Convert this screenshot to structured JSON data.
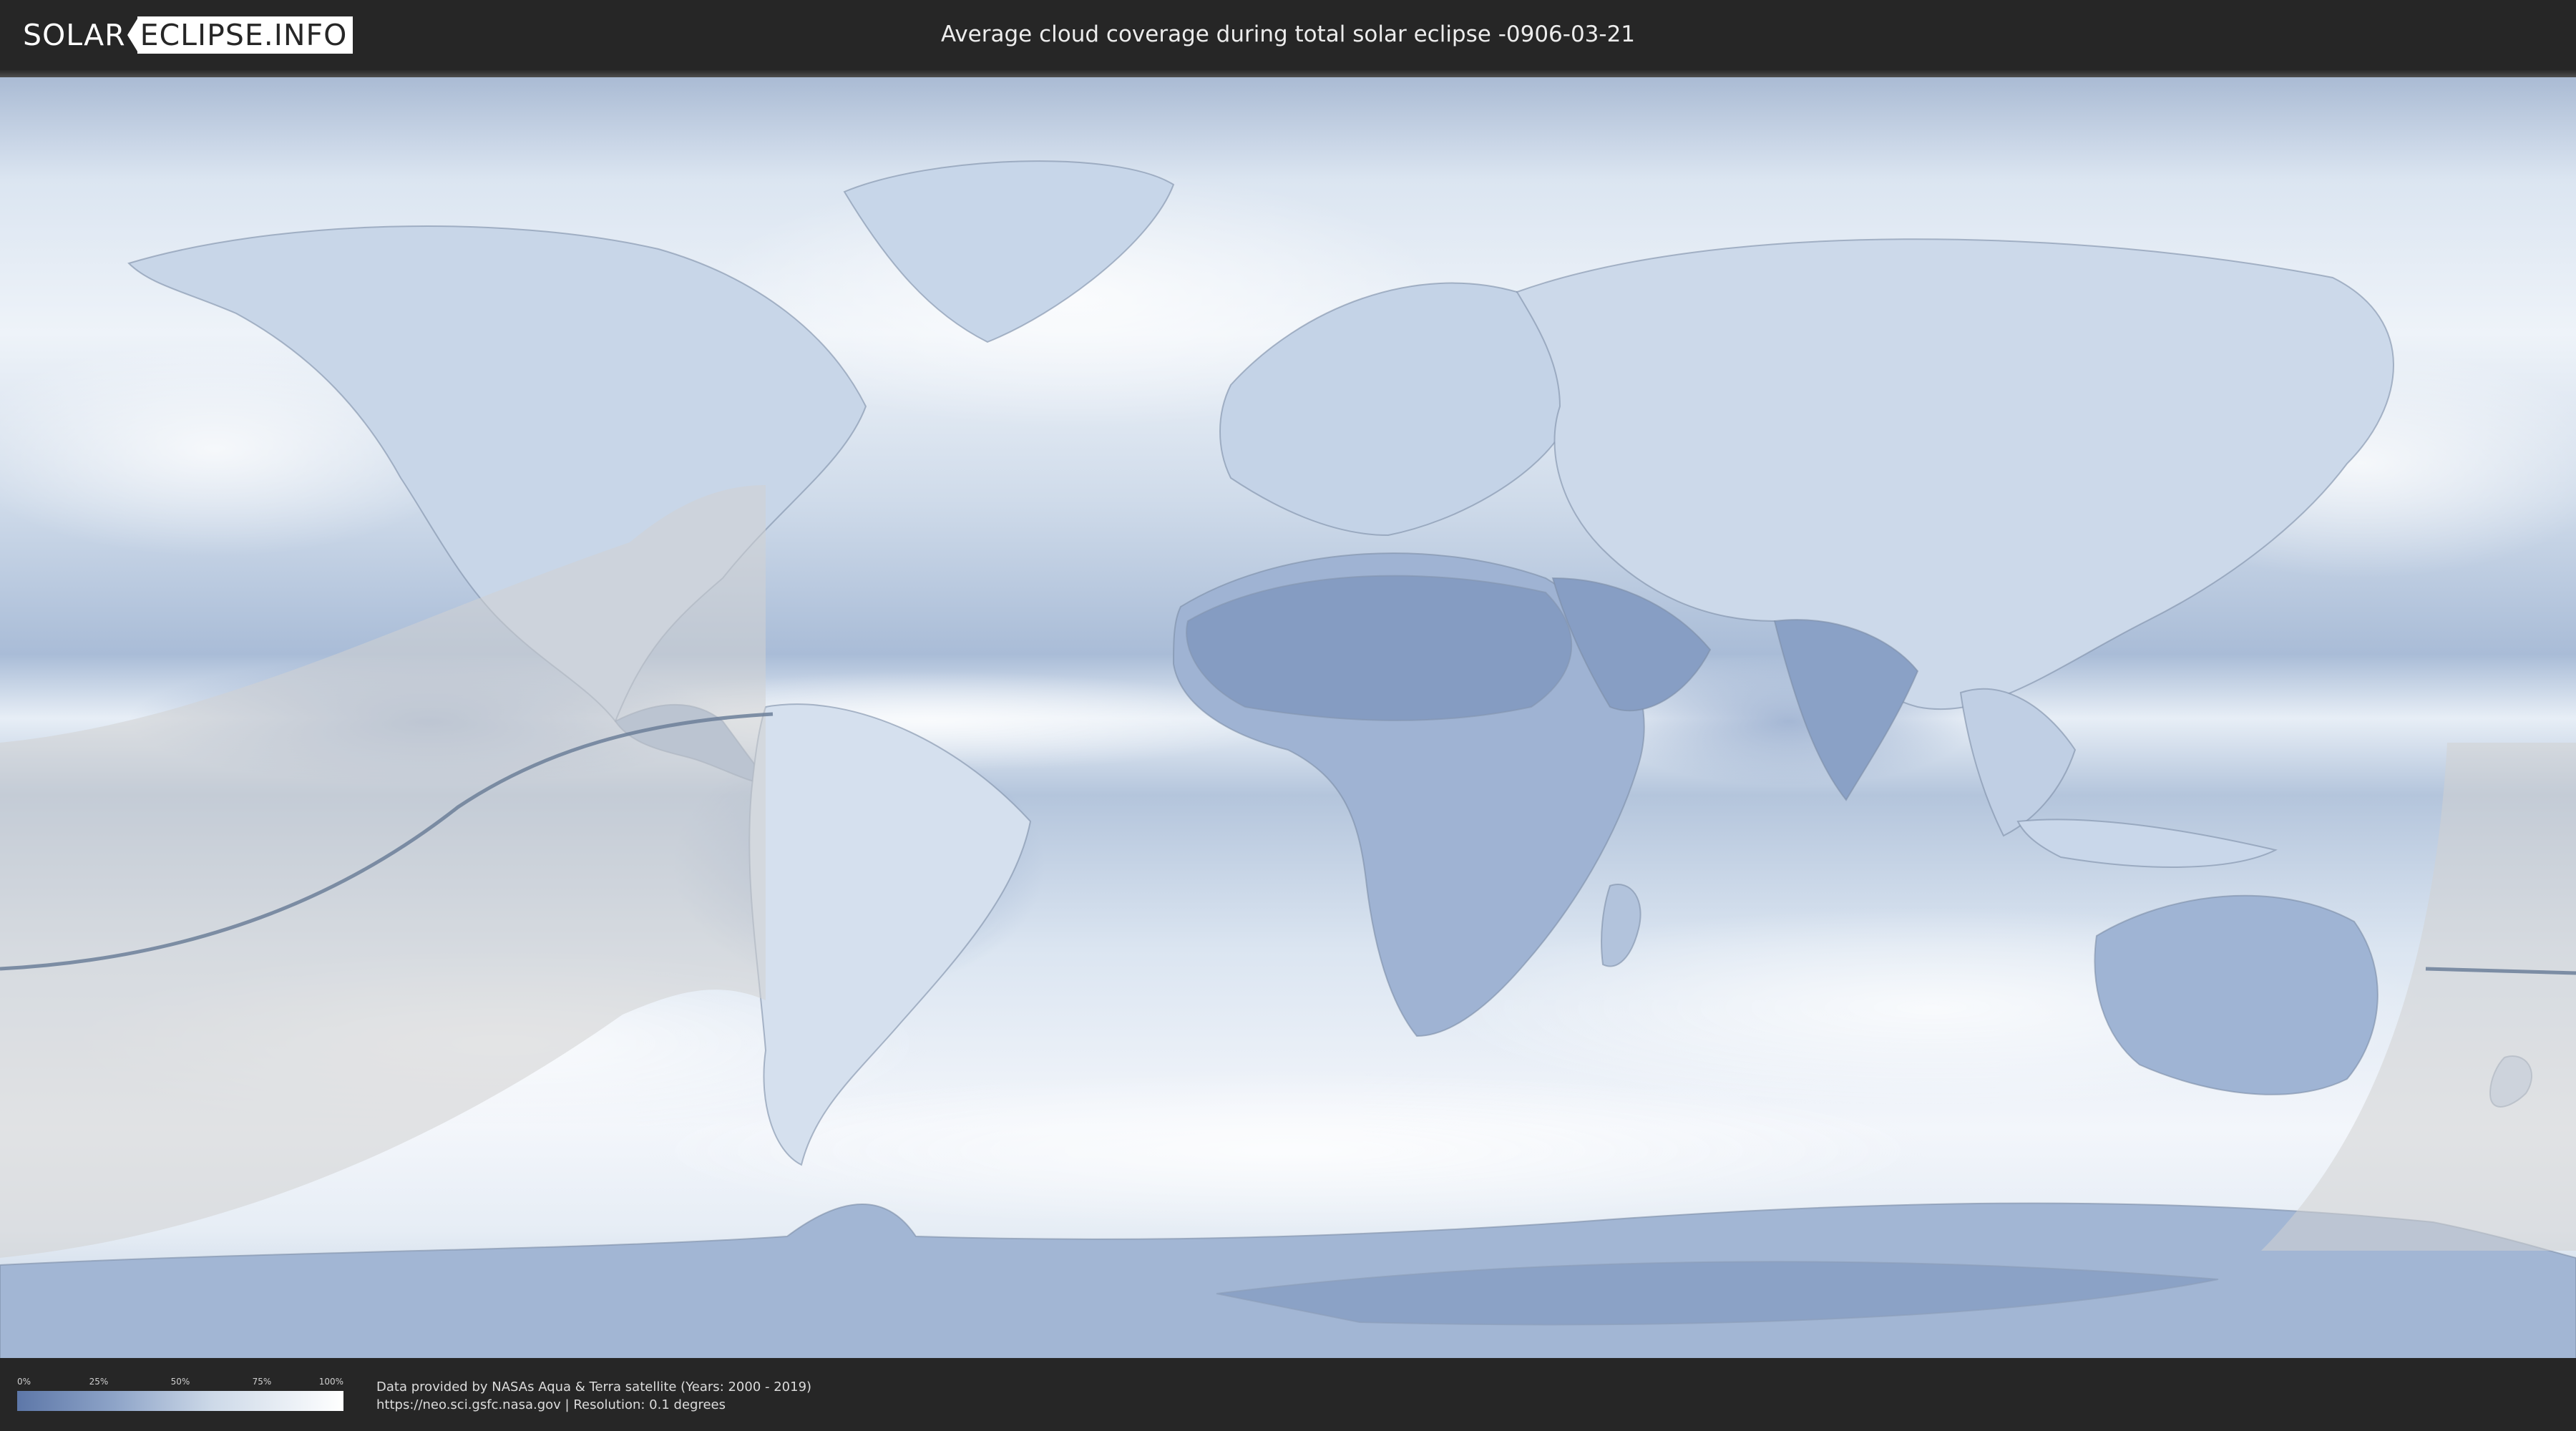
{
  "header": {
    "logo_left": "SOLAR",
    "logo_right": "ECLIPSE.INFO",
    "title": "Average cloud coverage during total solar eclipse -0906-03-21"
  },
  "map": {
    "description_icon": "world-cloud-coverage-map",
    "colors": {
      "clear_sky": "#5d77a8",
      "mid_cloud": "#aebfd8",
      "full_cloud": "#ffffff",
      "eclipse_shadow_overlay": "#d2d2d2",
      "central_line": "#6c7f99"
    }
  },
  "legend": {
    "ticks": [
      "0%",
      "25%",
      "50%",
      "75%",
      "100%"
    ]
  },
  "credits": {
    "line1": "Data provided by NASAs Aqua & Terra satellite (Years: 2000 - 2019)",
    "line2": "https://neo.sci.gsfc.nasa.gov | Resolution: 0.1 degrees"
  }
}
